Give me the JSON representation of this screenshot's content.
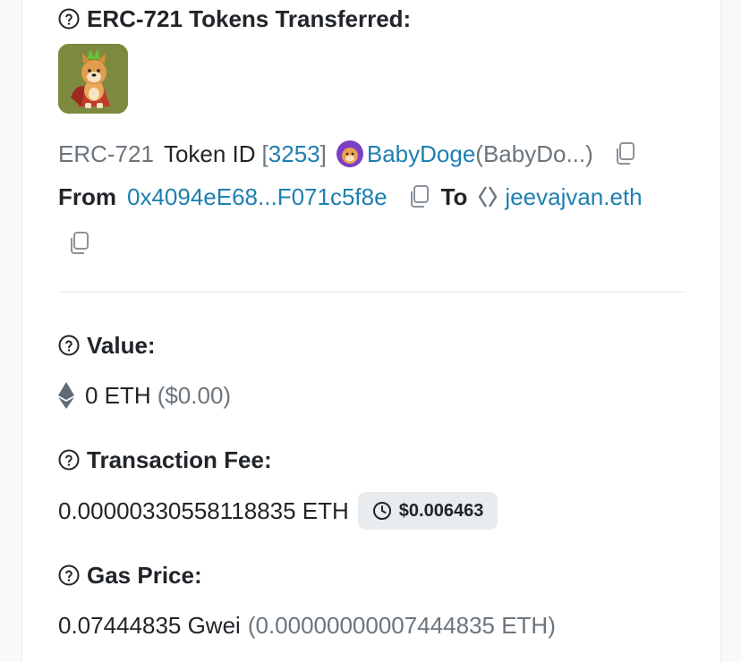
{
  "tokens_section": {
    "title": "ERC-721 Tokens Transferred:",
    "standard": "ERC-721",
    "token_id_label": "Token ID",
    "token_id": "3253",
    "token_name": "BabyDoge",
    "token_symbol": "(BabyDo...)",
    "from_label": "From",
    "from_address": "0x4094eE68...F071c5f8e",
    "to_label": "To",
    "to_address": "jeevajvan.eth"
  },
  "value_section": {
    "title": "Value:",
    "amount": "0 ETH",
    "usd": "($0.00)"
  },
  "fee_section": {
    "title": "Transaction Fee:",
    "amount": "0.00000330558118835 ETH",
    "usd_badge": "$0.006463"
  },
  "gas_section": {
    "title": "Gas Price:",
    "gwei": "0.07444835 Gwei",
    "eth": "(0.00000000007444835 ETH)"
  }
}
